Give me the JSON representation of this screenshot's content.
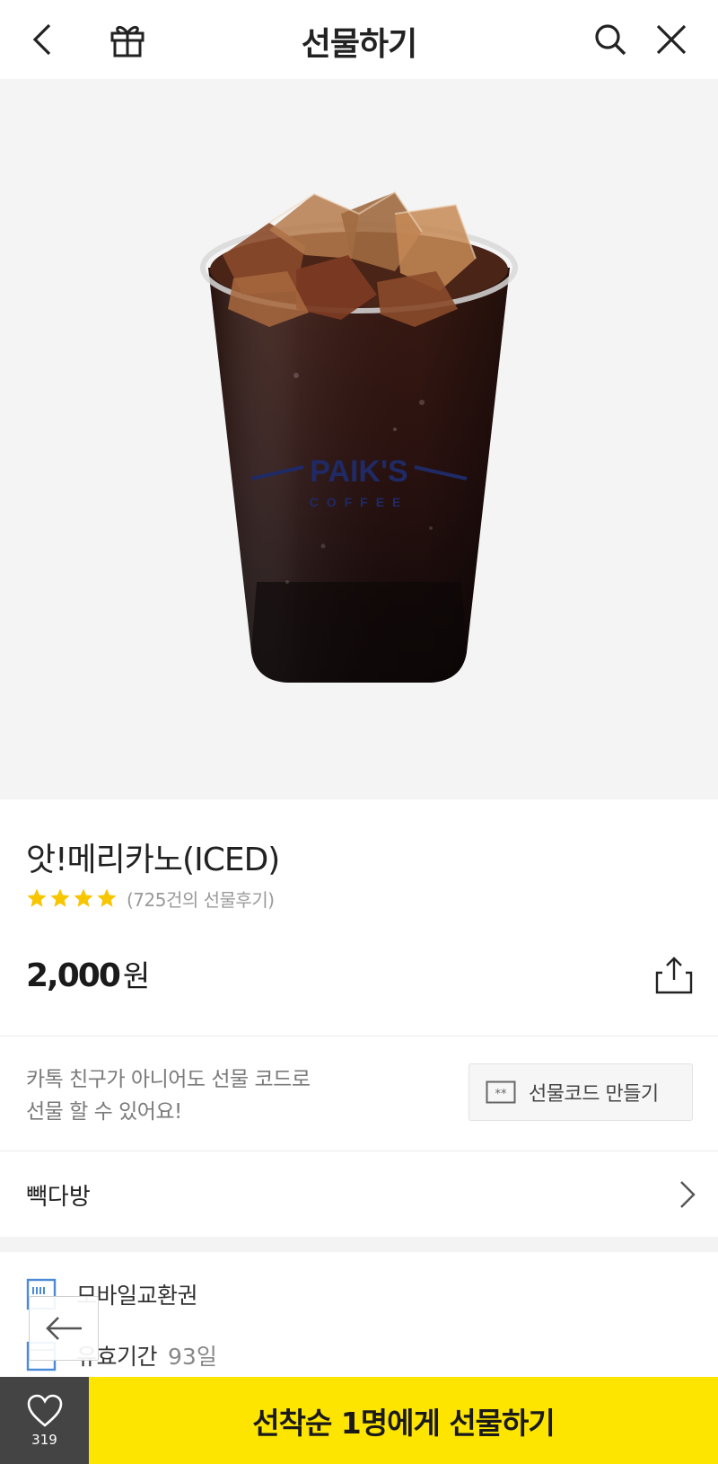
{
  "header": {
    "title": "선물하기",
    "back_icon": "chevron-left-icon",
    "gift_icon": "gift-box-icon",
    "search_icon": "search-icon",
    "close_icon": "close-icon"
  },
  "product": {
    "image_icon": "iced-americano-cup",
    "cup_logo_text": "PAIK'S",
    "cup_logo_sub": "COFFEE",
    "name": "앗!메리카노(ICED)",
    "rating_stars": 4,
    "review_count_text": "(725건의 선물후기)",
    "price": "2,000",
    "price_unit": "원",
    "share_icon": "share-icon"
  },
  "gift_code": {
    "line1": "카톡 친구가 아니어도 선물 코드로",
    "line2": "선물 할 수 있어요!",
    "button_label": "선물코드 만들기",
    "button_icon": "ticket-code-icon"
  },
  "brand": {
    "name": "빽다방",
    "chevron_icon": "chevron-right-icon"
  },
  "info": {
    "type_label": "모바일교환권",
    "type_icon": "voucher-icon",
    "validity_label": "유효기간",
    "validity_value": "93일",
    "validity_icon": "calendar-icon"
  },
  "floating_back_icon": "arrow-left-icon",
  "bottom": {
    "like_icon": "heart-icon",
    "like_count": "319",
    "gift_button_label": "선착순 1명에게 선물하기"
  },
  "colors": {
    "accent_yellow": "#fee500",
    "like_bg": "#444444",
    "star": "#f7c600"
  }
}
